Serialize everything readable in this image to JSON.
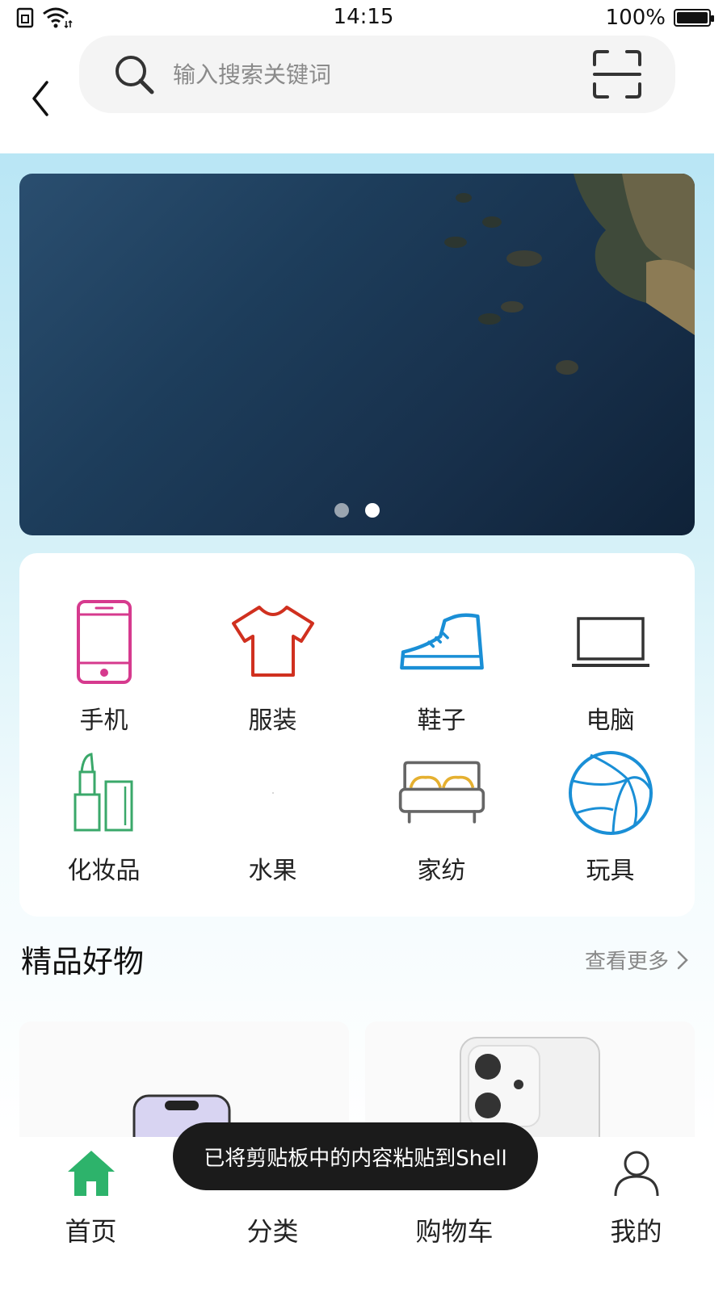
{
  "status_bar": {
    "time": "14:15",
    "battery": "100%"
  },
  "header": {
    "search_placeholder": "输入搜索关键词"
  },
  "banner": {
    "dots": 2,
    "active_dot": 2
  },
  "categories": [
    {
      "label": "手机",
      "icon": "phone-icon",
      "color": "#d63a8e"
    },
    {
      "label": "服装",
      "icon": "tshirt-icon",
      "color": "#d0301f"
    },
    {
      "label": "鞋子",
      "icon": "shoe-icon",
      "color": "#1a8fd6"
    },
    {
      "label": "电脑",
      "icon": "laptop-icon",
      "color": "#333333"
    },
    {
      "label": "化妆品",
      "icon": "lipstick-icon",
      "color": "#3aa86a"
    },
    {
      "label": "水果",
      "icon": "fruit-icon",
      "color": "#cccccc"
    },
    {
      "label": "家纺",
      "icon": "bed-icon",
      "color": "#555555"
    },
    {
      "label": "玩具",
      "icon": "ball-icon",
      "color": "#1a8fd6"
    }
  ],
  "section": {
    "title": "精品好物",
    "more": "查看更多"
  },
  "bottom_nav": [
    {
      "label": "首页",
      "icon": "home-icon",
      "active": true
    },
    {
      "label": "分类",
      "icon": "category-icon"
    },
    {
      "label": "购物车",
      "icon": "cart-icon"
    },
    {
      "label": "我的",
      "icon": "user-icon"
    }
  ],
  "toast": "已将剪贴板中的内容粘贴到Shell",
  "colors": {
    "accent": "#2db36b"
  }
}
